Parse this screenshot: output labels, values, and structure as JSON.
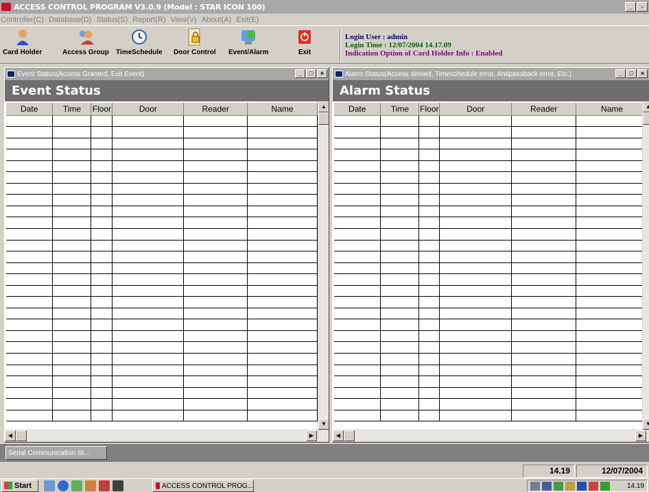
{
  "window": {
    "title": "ACCESS CONTROL PROGRAM V3.0.9 (Model : STAR ICON 100)",
    "controls": [
      "_",
      "▫",
      ""
    ]
  },
  "menu": [
    "Controller(C)",
    "Database(D)",
    "Status(S)",
    "Report(R)",
    "View(V)",
    "About(A)",
    "Exit(E)"
  ],
  "toolbar": {
    "buttons": [
      {
        "label": "Card Holder",
        "icon": "person-icon"
      },
      {
        "label": "Access Group",
        "icon": "group-icon"
      },
      {
        "label": "TimeSchedule",
        "icon": "clock-icon"
      },
      {
        "label": "Door Control",
        "icon": "door-lock-icon"
      },
      {
        "label": "Event/Alarm",
        "icon": "event-alarm-icon"
      },
      {
        "label": "Exit",
        "icon": "power-icon"
      }
    ]
  },
  "login": {
    "user": "Login User : admin",
    "time": "Login Time : 12/07/2004 14.17.09",
    "indication": "Indication Option of Card Holder Info :  Enabled"
  },
  "event_panel": {
    "title": "Event Status(Access Granted, Exit Event)",
    "header": "Event Status",
    "columns": [
      "Date",
      "Time",
      "Floor",
      "Door",
      "Reader",
      "Name"
    ]
  },
  "alarm_panel": {
    "title": "Alarm Status(Access denied, Timeschedule error, Antipassback error, Etc.)",
    "header": "Alarm Status",
    "columns": [
      "Date",
      "Time",
      "Floor",
      "Door",
      "Reader",
      "Name"
    ]
  },
  "minimized_window": "Serial Communication St...",
  "status": {
    "time": "14.19",
    "date": "12/07/2004"
  },
  "taskbar": {
    "start": "Start",
    "task": "ACCESS CONTROL PROG...",
    "clock": "14.19"
  },
  "colors": {
    "panel_header_bg": "#6e6e6e",
    "login_user": "#000080",
    "login_time": "#006400",
    "indication": "#800080",
    "exit_icon": "#e0301e"
  }
}
